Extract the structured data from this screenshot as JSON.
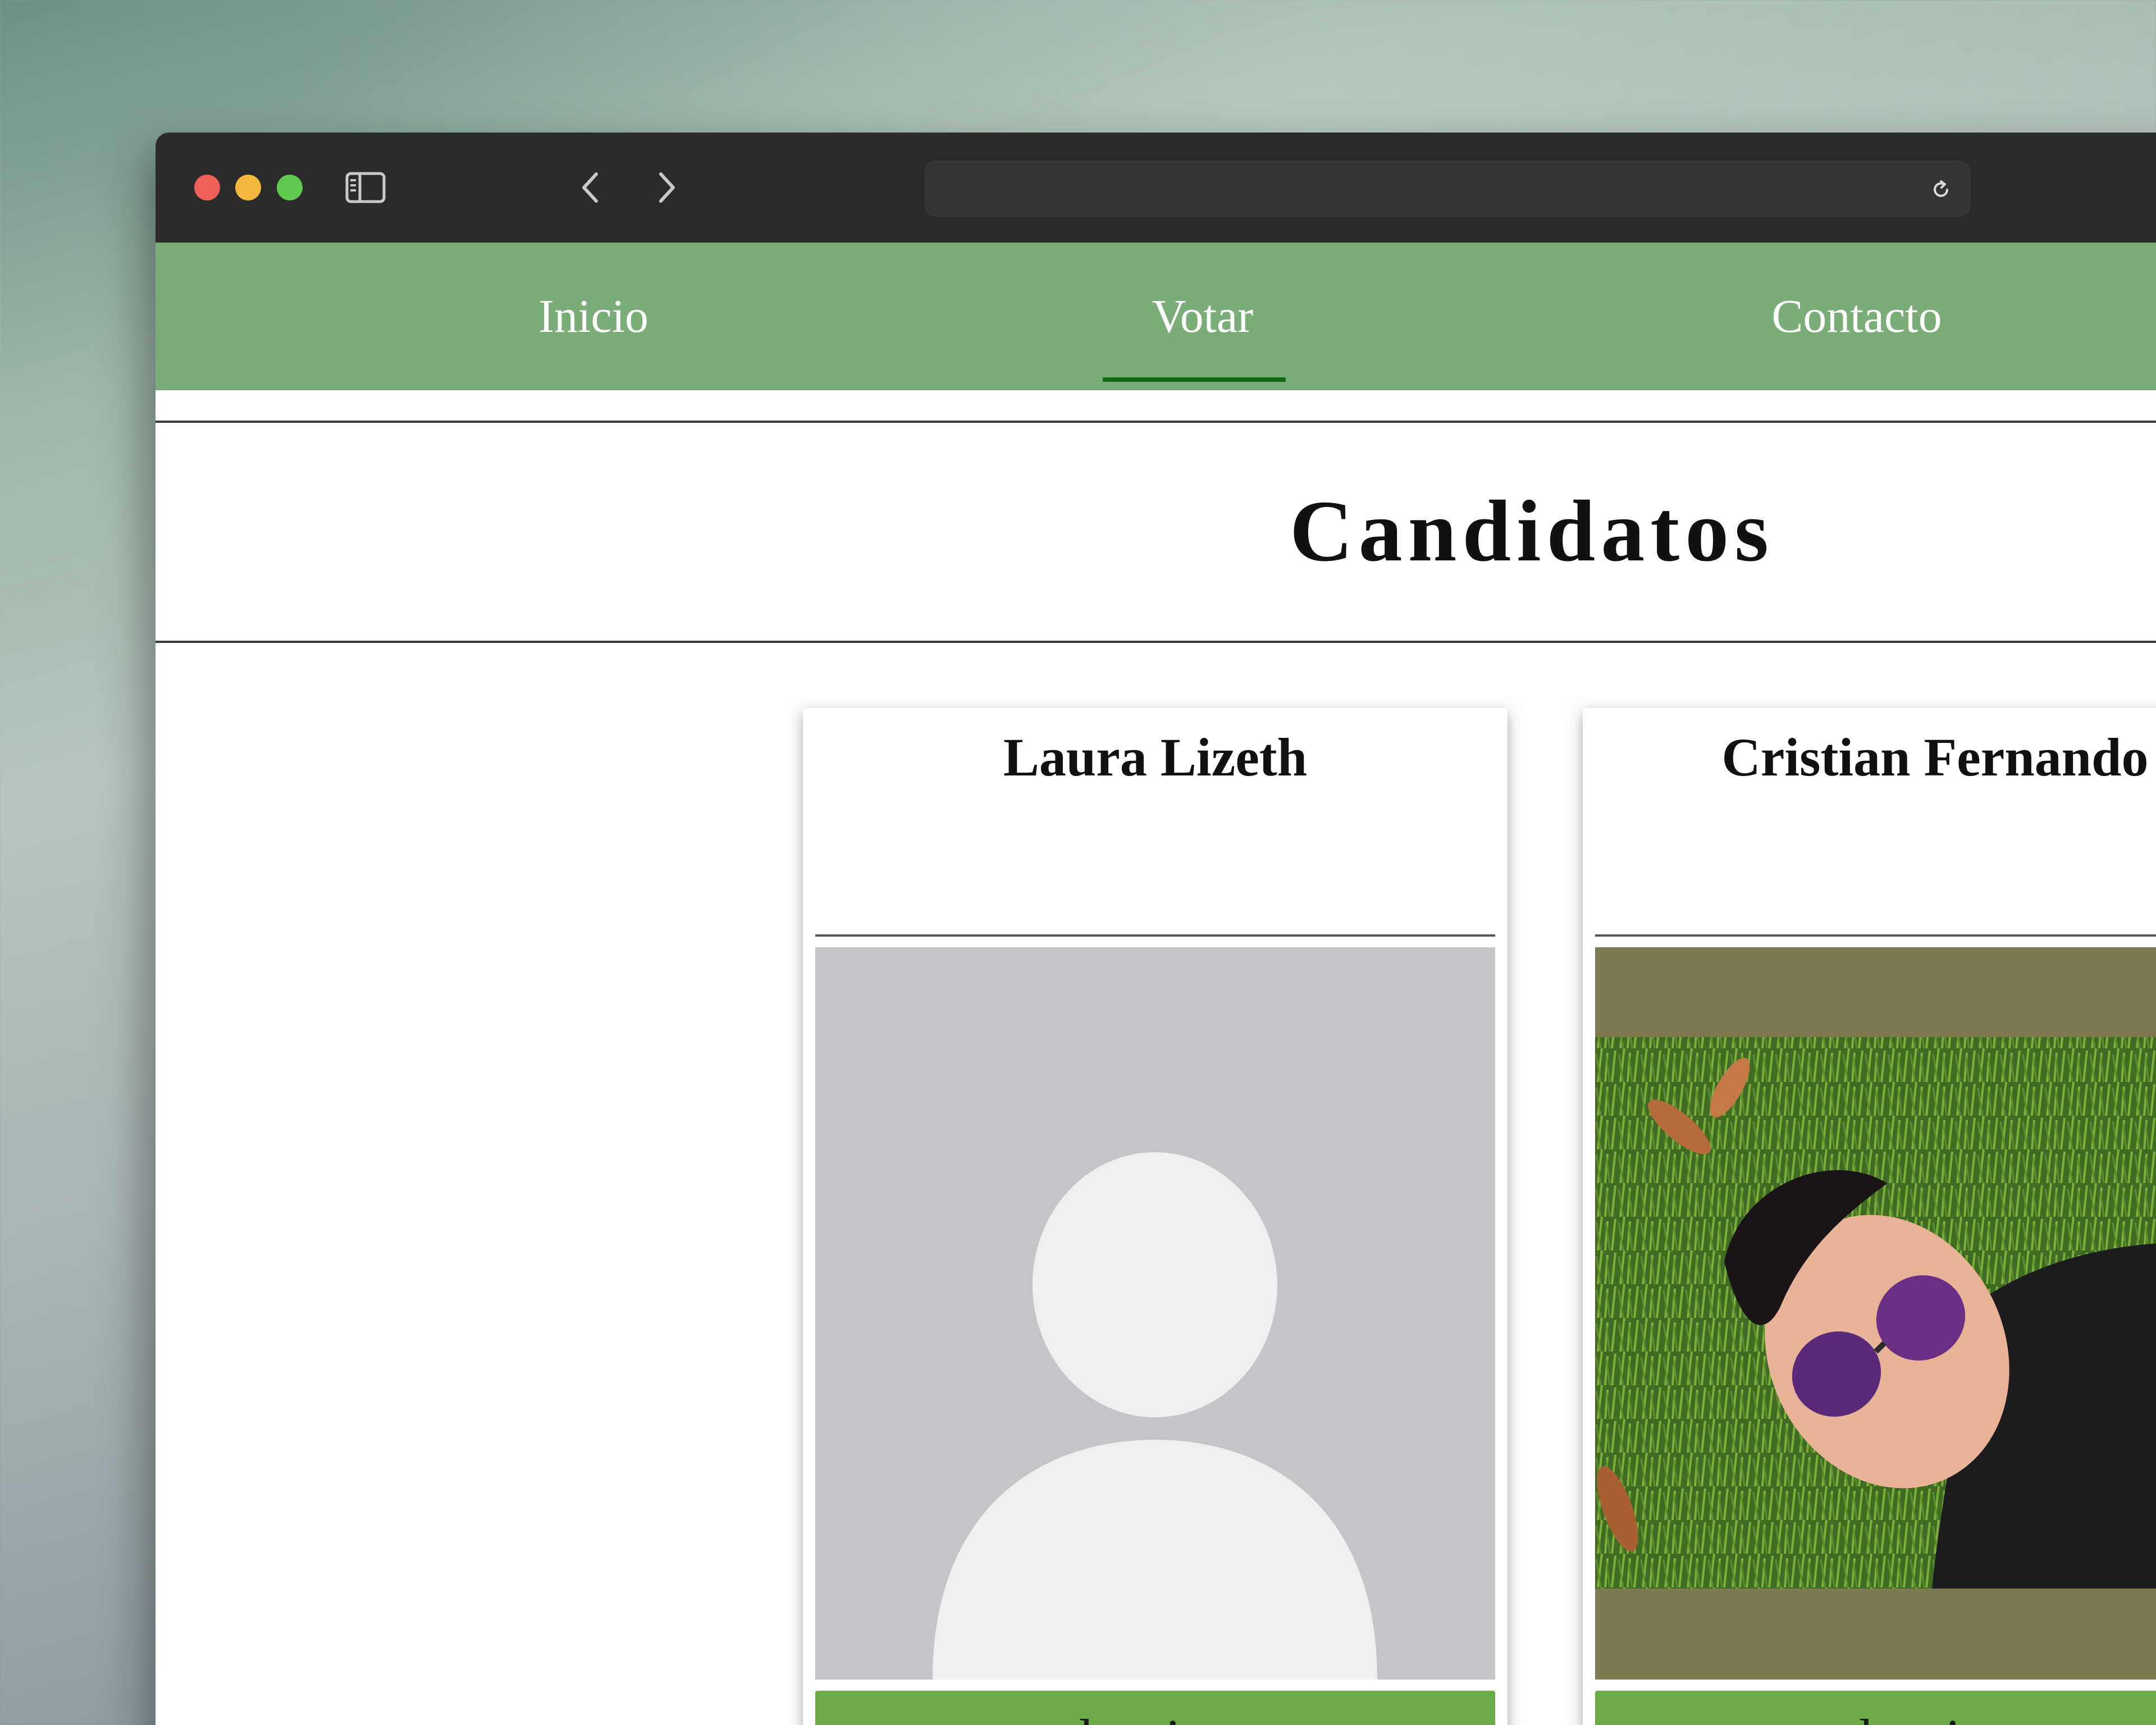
{
  "nav": {
    "links": [
      {
        "label": "Inicio"
      },
      {
        "label": "Votar",
        "active": true
      },
      {
        "label": "Contacto"
      }
    ]
  },
  "page": {
    "title": "Candidatos"
  },
  "candidates": [
    {
      "name": "Laura Lizeth",
      "photo": "default-avatar-placeholder",
      "button_label": "seleccionar"
    },
    {
      "name": "Cristian Fernando",
      "photo": "candidate-photo",
      "button_label": "seleccionar"
    }
  ],
  "colors": {
    "titlebar": "#2c2b2b",
    "navbar": "#7aad78",
    "nav_active_underline": "#0e6b13",
    "select_button": "#6aab47",
    "placeholder_bg": "#c4c5c8",
    "placeholder_figure": "#efeff0"
  }
}
